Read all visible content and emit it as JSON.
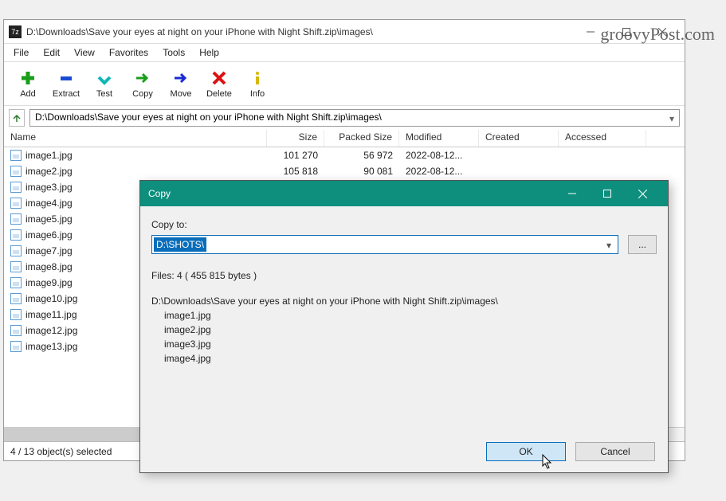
{
  "window": {
    "title": "D:\\Downloads\\Save your eyes at night on your iPhone with Night Shift.zip\\images\\",
    "app_icon_text": "7z"
  },
  "menus": [
    "File",
    "Edit",
    "View",
    "Favorites",
    "Tools",
    "Help"
  ],
  "toolbar": [
    {
      "label": "Add",
      "icon": "add"
    },
    {
      "label": "Extract",
      "icon": "extract"
    },
    {
      "label": "Test",
      "icon": "test"
    },
    {
      "label": "Copy",
      "icon": "copy"
    },
    {
      "label": "Move",
      "icon": "move"
    },
    {
      "label": "Delete",
      "icon": "delete"
    },
    {
      "label": "Info",
      "icon": "info"
    }
  ],
  "address": "D:\\Downloads\\Save your eyes at night on your iPhone with Night Shift.zip\\images\\",
  "columns": [
    "Name",
    "Size",
    "Packed Size",
    "Modified",
    "Created",
    "Accessed"
  ],
  "files": [
    {
      "name": "image1.jpg",
      "size": "101 270",
      "psize": "56 972",
      "mod": "2022-08-12..."
    },
    {
      "name": "image2.jpg",
      "size": "105 818",
      "psize": "90 081",
      "mod": "2022-08-12..."
    },
    {
      "name": "image3.jpg",
      "size": "",
      "psize": "",
      "mod": ""
    },
    {
      "name": "image4.jpg",
      "size": "",
      "psize": "",
      "mod": ""
    },
    {
      "name": "image5.jpg",
      "size": "",
      "psize": "",
      "mod": ""
    },
    {
      "name": "image6.jpg",
      "size": "",
      "psize": "",
      "mod": ""
    },
    {
      "name": "image7.jpg",
      "size": "",
      "psize": "",
      "mod": ""
    },
    {
      "name": "image8.jpg",
      "size": "",
      "psize": "",
      "mod": ""
    },
    {
      "name": "image9.jpg",
      "size": "",
      "psize": "",
      "mod": ""
    },
    {
      "name": "image10.jpg",
      "size": "",
      "psize": "",
      "mod": ""
    },
    {
      "name": "image11.jpg",
      "size": "",
      "psize": "",
      "mod": ""
    },
    {
      "name": "image12.jpg",
      "size": "",
      "psize": "",
      "mod": ""
    },
    {
      "name": "image13.jpg",
      "size": "",
      "psize": "",
      "mod": ""
    }
  ],
  "status": "4 / 13 object(s) selected",
  "dialog": {
    "title": "Copy",
    "copy_to_label": "Copy to:",
    "path": "D:\\SHOTS\\",
    "summary": "Files: 4    ( 455 815 bytes )",
    "source_path": "D:\\Downloads\\Save your eyes at night on your iPhone with Night Shift.zip\\images\\",
    "items": [
      "image1.jpg",
      "image2.jpg",
      "image3.jpg",
      "image4.jpg"
    ],
    "ok": "OK",
    "cancel": "Cancel",
    "browse": "..."
  },
  "watermark": "groovyPost.com"
}
